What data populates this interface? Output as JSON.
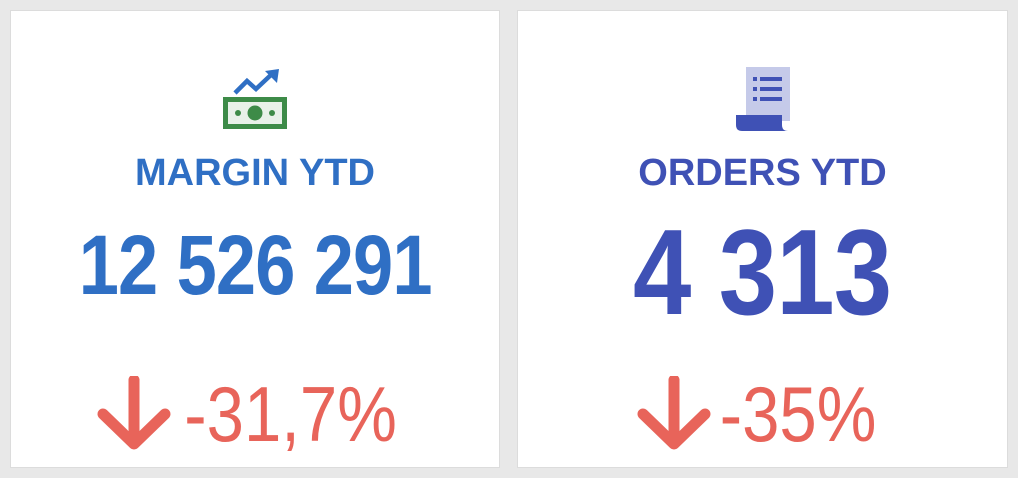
{
  "colors": {
    "margin_accent": "#2f6fc4",
    "orders_accent": "#3f51b5",
    "negative": "#e8645a",
    "money_green": "#3d8b48",
    "orders_icon": "#3f51b5"
  },
  "cards": [
    {
      "icon": "money-trend-icon",
      "title": "MARGIN YTD",
      "value": "12 526 291",
      "change_icon": "arrow-down-icon",
      "change": "-31,7%"
    },
    {
      "icon": "receipt-list-icon",
      "title": "ORDERS YTD",
      "value": "4 313",
      "change_icon": "arrow-down-icon",
      "change": "-35%"
    }
  ]
}
